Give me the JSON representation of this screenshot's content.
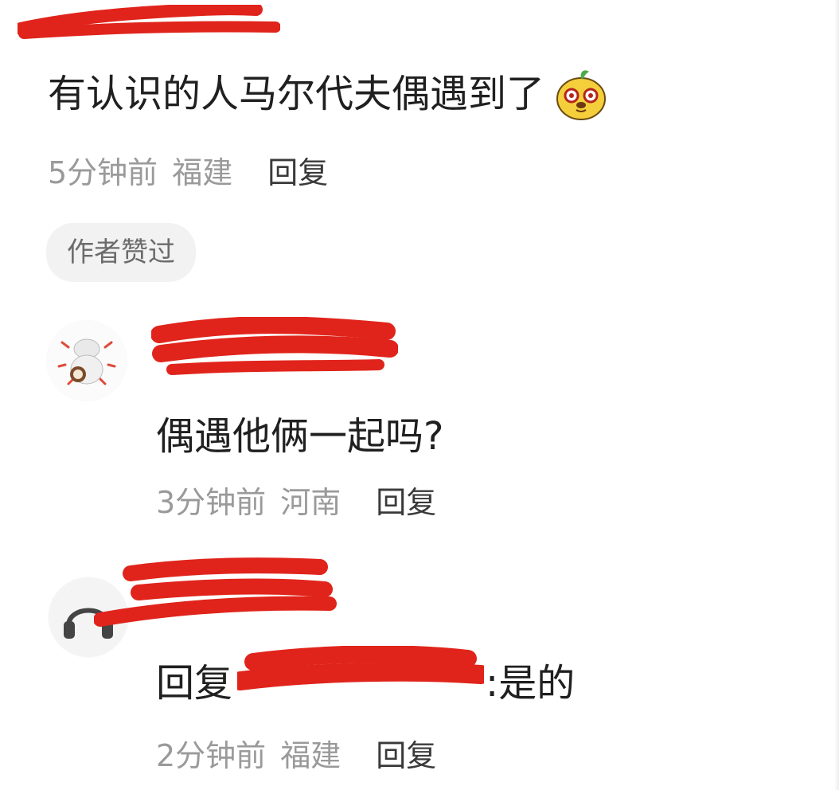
{
  "top_comment": {
    "text": "有认识的人马尔代夫偶遇到了",
    "emoji": "mango-face-emoji",
    "time": "5分钟前",
    "location": "福建",
    "reply_label": "回复",
    "badge": "作者赞过"
  },
  "replies": [
    {
      "avatar": "cartoon-character-avatar",
      "text": "偶遇他俩一起吗?",
      "time": "3分钟前",
      "location": "河南",
      "reply_label": "回复"
    },
    {
      "avatar": "headphones-avatar",
      "prefix": "回复",
      "suffix": ":是的",
      "time": "2分钟前",
      "location": "福建",
      "reply_label": "回复"
    }
  ],
  "colors": {
    "redaction": "#e0241b",
    "meta_gray": "#9a9a9a",
    "badge_bg": "#f2f2f2"
  }
}
